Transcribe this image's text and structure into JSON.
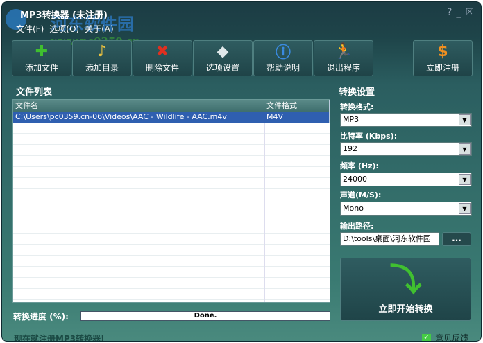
{
  "window": {
    "title": "MP3转换器 (未注册)",
    "help": "?",
    "minimize": "_",
    "close": "☒",
    "watermark": "河东软件园",
    "watermark_url": "www.pc0359.cn"
  },
  "menu": [
    "文件(F)",
    "选项(O)",
    "关于(A)"
  ],
  "toolbar": [
    {
      "label": "添加文件",
      "icon": "plus-icon",
      "glyph": "✚",
      "color": "#3fbf2f"
    },
    {
      "label": "添加目录",
      "icon": "folder-music-icon",
      "glyph": "♪",
      "color": "#e8c040"
    },
    {
      "label": "删除文件",
      "icon": "delete-x-icon",
      "glyph": "✖",
      "color": "#e03020"
    },
    {
      "label": "选项设置",
      "icon": "cube-icon",
      "glyph": "◆",
      "color": "#dfe8ea"
    },
    {
      "label": "帮助说明",
      "icon": "info-icon",
      "glyph": "ⓘ",
      "color": "#3a8ae0"
    },
    {
      "label": "退出程序",
      "icon": "running-man-icon",
      "glyph": "🏃",
      "color": "#f0a020"
    },
    {
      "label": "立即注册",
      "icon": "dollar-coin-icon",
      "glyph": "$",
      "color": "#f09020"
    }
  ],
  "file_list": {
    "title": "文件列表",
    "columns": [
      "文件名",
      "文件格式"
    ],
    "rows": [
      [
        "C:\\Users\\pc0359.cn-06\\Videos\\AAC - Wildlife - AAC.m4v",
        "M4V"
      ]
    ]
  },
  "settings": {
    "title": "转换设置",
    "format_label": "转换格式:",
    "format": "MP3",
    "bitrate_label": "比特率 (Kbps):",
    "bitrate": "192",
    "freq_label": "频率 (Hz):",
    "freq": "24000",
    "channel_label": "声道(M/S):",
    "channel": "Mono",
    "output_label": "输出路径:",
    "output": "D:\\tools\\桌面\\河东软件园",
    "browse": "...",
    "start": "立即开始转换"
  },
  "progress": {
    "label": "转换进度 (%):",
    "status": "Done.",
    "percent": 100
  },
  "footer": {
    "register_link": "现在就注册MP3转换器!",
    "feedback": "意见反馈"
  }
}
